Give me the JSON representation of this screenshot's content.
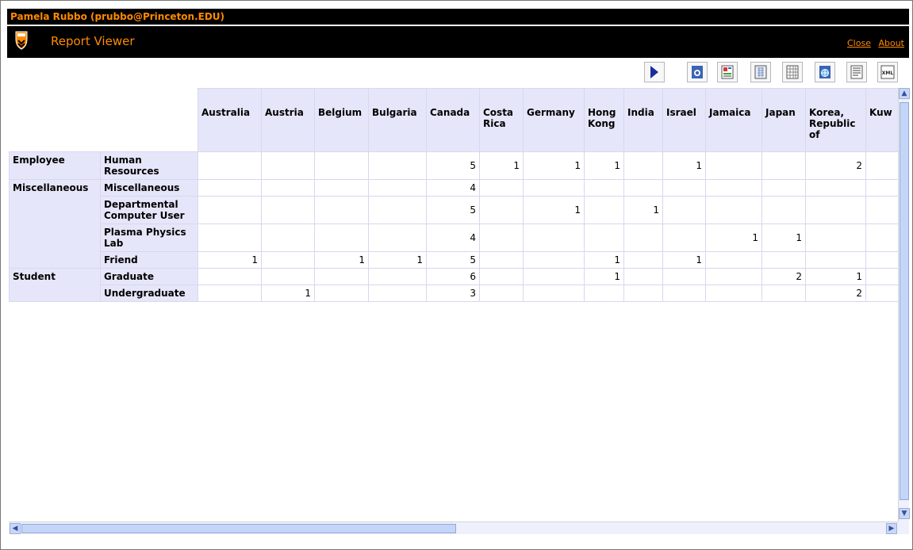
{
  "header": {
    "user": "Pamela Rubbo (prubbo@Princeton.EDU)",
    "title": "Report Viewer",
    "close_label": "Close",
    "about_label": "About"
  },
  "toolbar": {
    "buttons": [
      {
        "icon": "play-icon"
      },
      {
        "icon": "web-page-icon"
      },
      {
        "icon": "report-format-icon"
      },
      {
        "icon": "excel-format-icon"
      },
      {
        "icon": "grid-format-icon"
      },
      {
        "icon": "globe-export-icon"
      },
      {
        "icon": "text-format-icon"
      },
      {
        "icon": "xml-format-icon",
        "label": "XML"
      }
    ]
  },
  "report": {
    "columns": [
      "Australia",
      "Austria",
      "Belgium",
      "Bulgaria",
      "Canada",
      "Costa Rica",
      "Germany",
      "Hong Kong",
      "India",
      "Israel",
      "Jamaica",
      "Japan",
      "Korea, Republic of",
      "Kuw"
    ],
    "groups": [
      {
        "label": "Employee",
        "rows": [
          {
            "label": "Human Resources",
            "values": [
              "",
              "",
              "",
              "",
              "5",
              "1",
              "1",
              "1",
              "",
              "1",
              "",
              "",
              "2",
              ""
            ]
          }
        ]
      },
      {
        "label": "Miscellaneous",
        "rows": [
          {
            "label": "Miscellaneous",
            "values": [
              "",
              "",
              "",
              "",
              "4",
              "",
              "",
              "",
              "",
              "",
              "",
              "",
              "",
              ""
            ]
          },
          {
            "label": "Departmental Computer User",
            "values": [
              "",
              "",
              "",
              "",
              "5",
              "",
              "1",
              "",
              "1",
              "",
              "",
              "",
              "",
              ""
            ]
          },
          {
            "label": "Plasma Physics Lab",
            "values": [
              "",
              "",
              "",
              "",
              "4",
              "",
              "",
              "",
              "",
              "",
              "1",
              "1",
              "",
              ""
            ]
          },
          {
            "label": "Friend",
            "values": [
              "1",
              "",
              "1",
              "1",
              "5",
              "",
              "",
              "1",
              "",
              "1",
              "",
              "",
              "",
              ""
            ]
          }
        ]
      },
      {
        "label": "Student",
        "rows": [
          {
            "label": "Graduate",
            "values": [
              "",
              "",
              "",
              "",
              "6",
              "",
              "",
              "1",
              "",
              "",
              "",
              "2",
              "1",
              ""
            ]
          },
          {
            "label": "Undergraduate",
            "values": [
              "",
              "1",
              "",
              "",
              "3",
              "",
              "",
              "",
              "",
              "",
              "",
              "",
              "2",
              ""
            ]
          }
        ]
      }
    ]
  },
  "colors": {
    "bar_bg": "#000000",
    "accent": "#ff8a00",
    "header_cell_bg": "#e6e6fa",
    "grid_line": "#d7d7ef"
  }
}
